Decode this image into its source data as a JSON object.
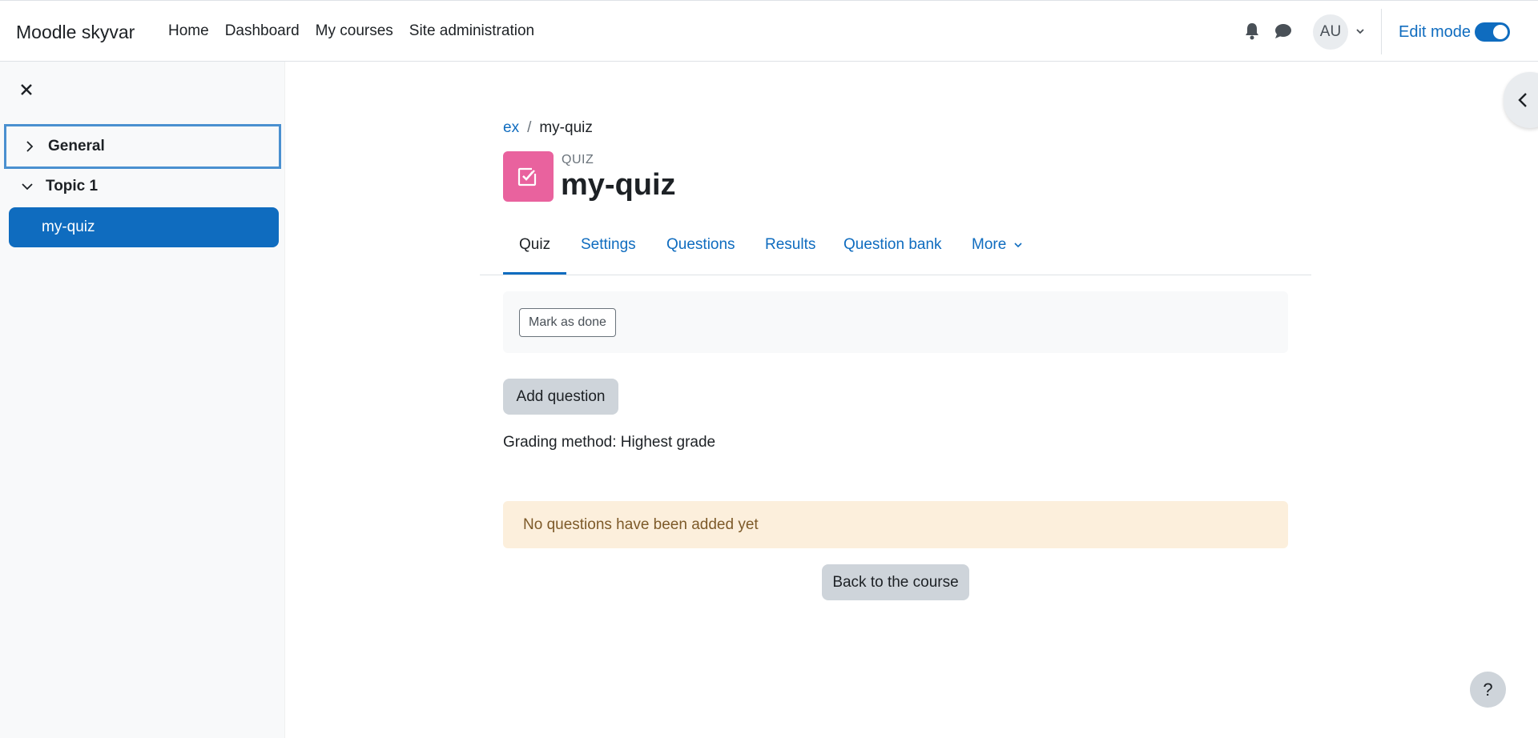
{
  "navbar": {
    "brand": "Moodle skyvar",
    "links": [
      "Home",
      "Dashboard",
      "My courses",
      "Site administration"
    ],
    "avatar_initials": "AU",
    "edit_mode_label": "Edit mode",
    "edit_mode_on": true
  },
  "drawer": {
    "sections": [
      {
        "label": "General",
        "expanded": false
      },
      {
        "label": "Topic 1",
        "expanded": true
      }
    ],
    "active_activity": "my-quiz"
  },
  "breadcrumb": {
    "course": "ex",
    "separator": "/",
    "current": "my-quiz"
  },
  "header": {
    "activity_type": "QUIZ",
    "title": "my-quiz",
    "icon_color": "#e9629e"
  },
  "tabs": [
    {
      "label": "Quiz",
      "active": true
    },
    {
      "label": "Settings"
    },
    {
      "label": "Questions"
    },
    {
      "label": "Results"
    },
    {
      "label": "Question bank"
    },
    {
      "label": "More"
    }
  ],
  "completion": {
    "mark_done_label": "Mark as done"
  },
  "actions": {
    "add_question_label": "Add question",
    "grading_method": "Grading method: Highest grade",
    "no_questions_notice": "No questions have been added yet",
    "back_to_course_label": "Back to the course"
  },
  "help": {
    "label": "?"
  },
  "colors": {
    "primary": "#0f6cbf",
    "warning_bg": "#fcefdc",
    "quiz_icon": "#e9629e"
  }
}
